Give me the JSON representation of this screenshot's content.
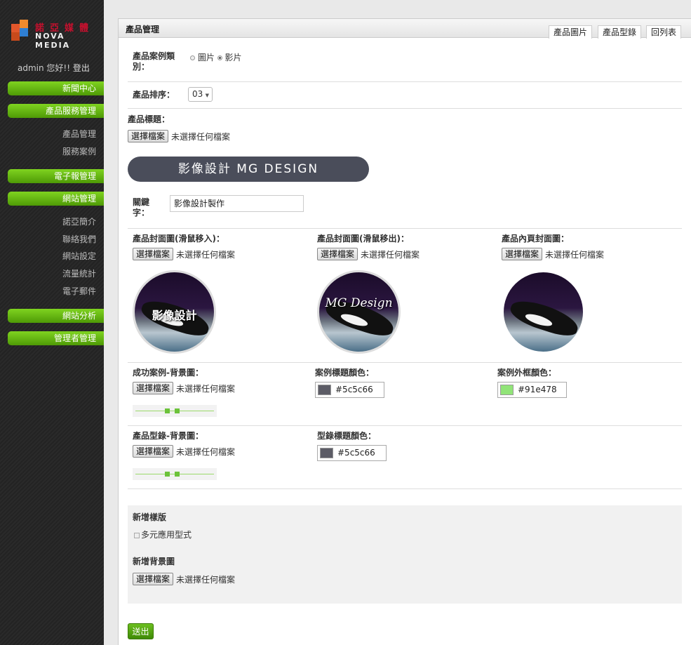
{
  "brand": {
    "name_cn": "諾亞媒體",
    "name_en": "NOVA MEDIA"
  },
  "user": {
    "greeting": "admin 您好!!",
    "logout": "登出"
  },
  "sidebar": {
    "menu": [
      {
        "label": "新聞中心"
      },
      {
        "label": "產品服務管理"
      },
      {
        "label": "電子報管理"
      },
      {
        "label": "網站管理"
      },
      {
        "label": "網站分析"
      },
      {
        "label": "管理者管理"
      }
    ],
    "product_sub": [
      "產品管理",
      "服務案例"
    ],
    "site_sub": [
      "諾亞簡介",
      "聯絡我們",
      "網站設定",
      "流量統計",
      "電子郵件"
    ]
  },
  "header": {
    "title": "產品管理",
    "tabs": [
      "產品圖片",
      "產品型錄",
      "回列表"
    ]
  },
  "form": {
    "category_label": "產品案例類別：",
    "category_options": [
      "圖片",
      "影片"
    ],
    "category_selected": "影片",
    "order_label": "產品排序：",
    "order_value": "03",
    "title_label": "產品標題：",
    "file_button": "選擇檔案",
    "no_file": "未選擇任何檔案",
    "banner_text": "影像設計 MG DESIGN",
    "keyword_label": "關鍵字：",
    "keyword_value": "影像設計製作",
    "cover_hover_in_label": "產品封面圖(滑鼠移入)：",
    "cover_hover_out_label": "產品封面圖(滑鼠移出)：",
    "inner_cover_label": "產品內頁封面圖：",
    "thumb1_caption": "影像設計",
    "thumb2_caption": "MG Design",
    "case_bg_label": "成功案例-背景圖：",
    "case_title_color_label": "案例標題顏色：",
    "case_title_color": "#5c5c66",
    "case_border_color_label": "案例外框顏色：",
    "case_border_color": "#91e478",
    "catalog_bg_label": "產品型錄-背景圖：",
    "catalog_title_color_label": "型錄標題顏色：",
    "catalog_title_color": "#5c5c66",
    "new_template_label": "新增樣版",
    "multi_use_label": "多元應用型式",
    "new_bg_label": "新增背景圖",
    "submit": "送出"
  }
}
